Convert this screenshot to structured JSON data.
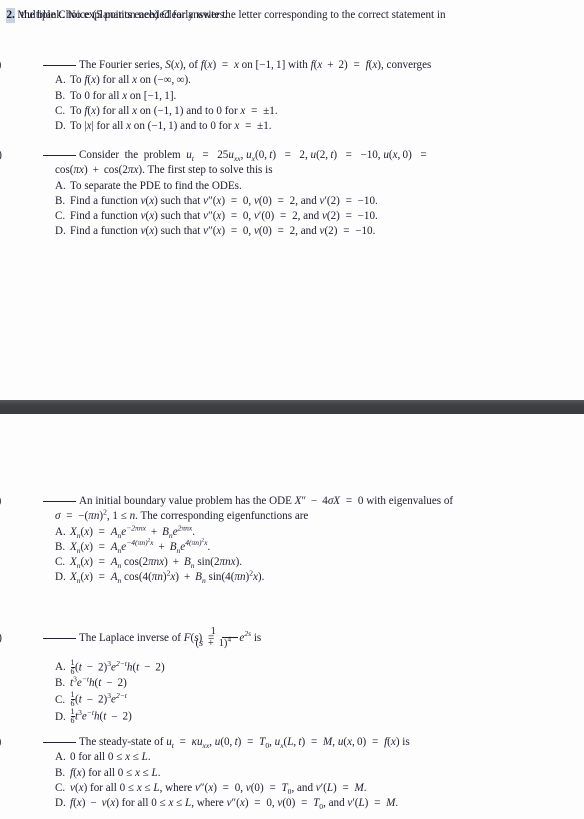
{
  "document": {
    "question_number": "2.",
    "heading_line1": "Multiple Choice (5 points each) Clearly write the letter corresponding to the correct statement in",
    "heading_line2": "the blank. No explanation needed for answers.",
    "band_color": "#3c4043",
    "text_color": "#1b1d2b",
    "page_background": "#fdfdfd"
  },
  "parts": {
    "a": {
      "label": "(a)",
      "stem": "The Fourier series, S(x), of f(x) = x on [-1,1] with f(x+2) = f(x), converges",
      "options": [
        {
          "letter": "A.",
          "text": "To f(x) for all x on (-∞, ∞)."
        },
        {
          "letter": "B.",
          "text": "To 0 for all x on [-1,1]."
        },
        {
          "letter": "C.",
          "text": "To f(x) for all x on (-1,1) and to 0 for x = ±1."
        },
        {
          "letter": "D.",
          "text": "To |x| for all x on (-1,1) and to 0 for x = ±1."
        }
      ]
    },
    "b": {
      "label": "(b)",
      "stem_line1": "Consider the problem u_t = 25u_xx, u_x(0,t) = 2, u(2,t) = -10, u(x,0) =",
      "stem_line2": "cos(πx) + cos(2πx). The first step to solve this is",
      "options": [
        {
          "letter": "A.",
          "text": "To separate the PDE to find the ODEs."
        },
        {
          "letter": "B.",
          "text": "Find a function v(x) such that v''(x) = 0, v(0) = 2, and v'(2) = -10."
        },
        {
          "letter": "C.",
          "text": "Find a function v(x) such that v''(x) = 0, v'(0) = 2, and v(2) = -10."
        },
        {
          "letter": "D.",
          "text": "Find a function v(x) such that v''(x) = 0, v(0) = 2, and v(2) = -10."
        }
      ]
    },
    "c": {
      "label": "(c)",
      "stem_line1": "An initial boundary value problem has the ODE X'' - 4σX = 0 with eigenvalues of",
      "stem_line2": "σ = -(πn)², 1 ≤ n. The corresponding eigenfunctions are",
      "options": [
        {
          "letter": "A.",
          "text": "X_n(x) = A_n e^{-2πnx} + B_n e^{2πnx}."
        },
        {
          "letter": "B.",
          "text": "X_n(x) = A_n e^{-4(πn)²x} + B_n e^{4(πn)²x}."
        },
        {
          "letter": "C.",
          "text": "X_n(x) = A_n cos(2πnx) + B_n sin(2πnx)."
        },
        {
          "letter": "D.",
          "text": "X_n(x) = A_n cos(4(πn)²x) + B_n sin(4(πn)²x)."
        }
      ]
    },
    "d": {
      "label": "(d)",
      "stem": "The Laplace inverse of F(s) = 1/(s+1)^4 e^{2s} is",
      "options": [
        {
          "letter": "A.",
          "text": "(1/6)(t-2)³ e^{2-t} h(t-2)"
        },
        {
          "letter": "B.",
          "text": "t³ e^{-t} h(t-2)"
        },
        {
          "letter": "C.",
          "text": "(1/6)(t-2)³ e^{2-t}"
        },
        {
          "letter": "D.",
          "text": "(1/6) t³ e^{-t} h(t-2)"
        }
      ]
    },
    "e": {
      "label": "(e)",
      "stem": "The steady-state of u_t = κu_xx, u(0,t) = T_0, u_x(L,t) = M, u(x,0) = f(x) is",
      "options": [
        {
          "letter": "A.",
          "text": "0 for all 0 ≤ x ≤ L."
        },
        {
          "letter": "B.",
          "text": "f(x) for all 0 ≤ x ≤ L."
        },
        {
          "letter": "C.",
          "text": "v(x) for all 0 ≤ x ≤ L, where v''(x) = 0, v(0) = T_0, and v'(L) = M."
        },
        {
          "letter": "D.",
          "text": "f(x) - v(x) for all 0 ≤ x ≤ L, where v''(x) = 0, v(0) = T_0, and v'(L) = M."
        }
      ]
    }
  }
}
